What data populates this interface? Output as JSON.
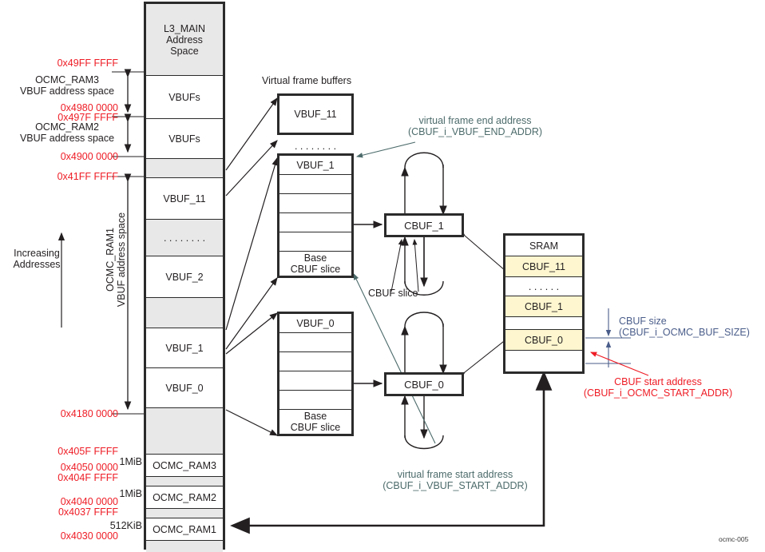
{
  "figure": {
    "id_label": "ocmc-005",
    "colors": {
      "address_red": "#ee1c25",
      "annotation_teal": "#4d6b6b",
      "annotation_blue": "#4a5d8a",
      "cbuf_fill": "#fdf6cf",
      "reserved_fill": "#e8e8e8",
      "outline": "#2b2b2b"
    }
  },
  "memory_map": {
    "title": "L3_MAIN\nAddress\nSpace",
    "rows": [
      {
        "label": "VBUFs",
        "kind": "white"
      },
      {
        "label": "VBUFs",
        "kind": "white"
      },
      {
        "label": "",
        "kind": "gray"
      },
      {
        "label": "VBUF_11",
        "kind": "white"
      },
      {
        "label": ". . . . . . . .",
        "kind": "gray"
      },
      {
        "label": "VBUF_2",
        "kind": "white"
      },
      {
        "label": "",
        "kind": "gray"
      },
      {
        "label": "VBUF_1",
        "kind": "white"
      },
      {
        "label": "VBUF_0",
        "kind": "white"
      },
      {
        "label": "",
        "kind": "gray"
      },
      {
        "label": "OCMC_RAM3",
        "kind": "white"
      },
      {
        "label": "",
        "kind": "gray"
      },
      {
        "label": "OCMC_RAM2",
        "kind": "white"
      },
      {
        "label": "",
        "kind": "gray"
      },
      {
        "label": "OCMC_RAM1",
        "kind": "white"
      },
      {
        "label": "",
        "kind": "gray"
      }
    ],
    "size_labels": [
      {
        "text": "1MiB"
      },
      {
        "text": "1MiB"
      },
      {
        "text": "512KiB"
      }
    ]
  },
  "addresses": [
    {
      "text": "0x49FF FFFF"
    },
    {
      "text": "0x4980 0000"
    },
    {
      "text": "0x497F FFFF"
    },
    {
      "text": "0x4900 0000"
    },
    {
      "text": "0x41FF FFFF"
    },
    {
      "text": "0x4180 0000"
    },
    {
      "text": "0x405F FFFF"
    },
    {
      "text": "0x4050 0000"
    },
    {
      "text": "0x404F FFFF"
    },
    {
      "text": "0x4040 0000"
    },
    {
      "text": "0x4037 FFFF"
    },
    {
      "text": "0x4030 0000"
    }
  ],
  "span_labels": {
    "ocmc_ram3": "OCMC_RAM3\nVBUF address space",
    "ocmc_ram2": "OCMC_RAM2\nVBUF address space",
    "ocmc_ram1": "OCMC_RAM1\nVBUF address space",
    "increasing": "Increasing\nAddresses"
  },
  "virtual_frame_buffers": {
    "title": "Virtual frame buffers",
    "vbuf_11": {
      "label": "VBUF_11"
    },
    "ellipsis": ". . . . . . . .",
    "vbuf_1": {
      "label": "VBUF_1",
      "slices": [
        "VBUF_1",
        "",
        "",
        "",
        "",
        "Base\nCBUF slice"
      ]
    },
    "vbuf_0": {
      "label": "VBUF_0",
      "slices": [
        "VBUF_0",
        "",
        "",
        "",
        "",
        "Base\nCBUF slice"
      ]
    }
  },
  "cbufs": {
    "cbuf_1": "CBUF_1",
    "cbuf_0": "CBUF_0",
    "slice_label": "CBUF slice"
  },
  "sram": {
    "title": "SRAM",
    "rows": [
      {
        "label": "SRAM",
        "fill": "white"
      },
      {
        "label": "CBUF_11",
        "fill": "yellow"
      },
      {
        "label": ". . . . . .",
        "fill": "white"
      },
      {
        "label": "CBUF_1",
        "fill": "yellow"
      },
      {
        "label": "",
        "fill": "white"
      },
      {
        "label": "CBUF_0",
        "fill": "yellow"
      },
      {
        "label": "",
        "fill": "white"
      }
    ]
  },
  "annotations": {
    "vbuf_end_addr": "virtual frame end address\n(CBUF_i_VBUF_END_ADDR)",
    "vbuf_start_addr": "virtual frame start address\n(CBUF_i_VBUF_START_ADDR)",
    "cbuf_size": "CBUF size\n(CBUF_i_OCMC_BUF_SIZE)",
    "cbuf_start_addr": "CBUF start address\n(CBUF_i_OCMC_START_ADDR)"
  }
}
